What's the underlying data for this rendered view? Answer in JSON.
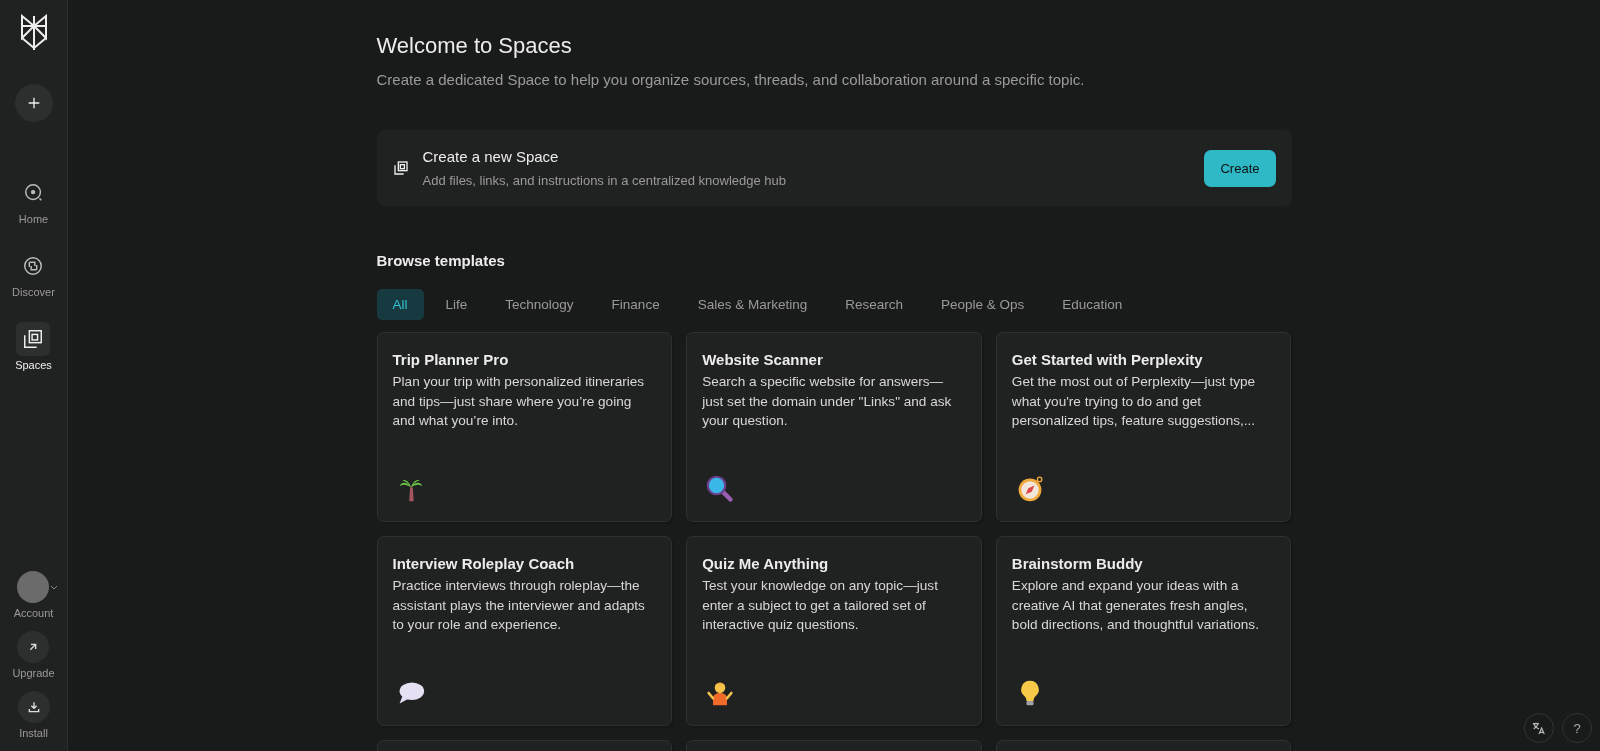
{
  "sidebar": {
    "top_items": [
      {
        "label": "Home",
        "selected": false
      },
      {
        "label": "Discover",
        "selected": false
      },
      {
        "label": "Spaces",
        "selected": true
      }
    ],
    "bottom_items": [
      {
        "label": "Account"
      },
      {
        "label": "Upgrade"
      },
      {
        "label": "Install"
      }
    ]
  },
  "header": {
    "title": "Welcome to Spaces",
    "subtitle": "Create a dedicated Space to help you organize sources, threads, and collaboration around a specific topic."
  },
  "create_card": {
    "title": "Create a new Space",
    "description": "Add files, links, and instructions in a centralized knowledge hub",
    "button": "Create"
  },
  "templates": {
    "heading": "Browse templates",
    "tabs": [
      {
        "label": "All",
        "selected": true
      },
      {
        "label": "Life",
        "selected": false
      },
      {
        "label": "Technology",
        "selected": false
      },
      {
        "label": "Finance",
        "selected": false
      },
      {
        "label": "Sales & Marketing",
        "selected": false
      },
      {
        "label": "Research",
        "selected": false
      },
      {
        "label": "People & Ops",
        "selected": false
      },
      {
        "label": "Education",
        "selected": false
      }
    ],
    "cards": [
      {
        "title": "Trip Planner Pro",
        "description": "Plan your trip with personalized itineraries and tips—just share where you’re going and what you’re into."
      },
      {
        "title": "Website Scanner",
        "description": "Search a specific website for answers—just set the domain under \"Links\" and ask your question."
      },
      {
        "title": "Get Started with Perplexity",
        "description": "Get the most out of Perplexity—just type what you're trying to do and get personalized tips, feature suggestions,..."
      },
      {
        "title": "Interview Roleplay Coach",
        "description": "Practice interviews through roleplay—the assistant plays the interviewer and adapts to your role and experience."
      },
      {
        "title": "Quiz Me Anything",
        "description": "Test your knowledge on any topic—just enter a subject to get a tailored set of interactive quiz questions."
      },
      {
        "title": "Brainstorm Buddy",
        "description": "Explore and expand your ideas with a creative AI that generates fresh angles, bold directions, and thoughtful variations."
      }
    ]
  },
  "help_button": "?"
}
